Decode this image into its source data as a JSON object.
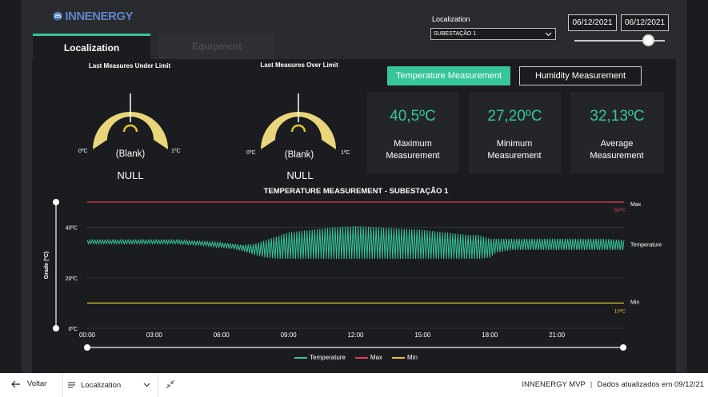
{
  "brand": {
    "name": "INNENERGY"
  },
  "tabs": [
    {
      "label": "Localization",
      "active": true
    },
    {
      "label": "Equipment",
      "active": false
    }
  ],
  "filters": {
    "localization_label": "Localization",
    "localization_value": "SUBESTAÇÃO 1",
    "date_start": "06/12/2021",
    "date_end": "06/12/2021"
  },
  "gauges": [
    {
      "title": "Last Measures Under Limit",
      "min": "0ºC",
      "max": "1ºC",
      "center": "(Blank)",
      "value": "NULL"
    },
    {
      "title": "Last Measures Over Limit",
      "min": "0ºC",
      "max": "1ºC",
      "center": "(Blank)",
      "value": "NULL"
    }
  ],
  "toggles": {
    "temperature": "Temperature Measurement",
    "humidity": "Humidity Measurement"
  },
  "cards": [
    {
      "value": "40,5ºC",
      "label": "Maximum Measurement"
    },
    {
      "value": "27,20ºC",
      "label": "Minimum Measurement"
    },
    {
      "value": "32,13ºC",
      "label": "Average Measurement"
    }
  ],
  "colors": {
    "accent": "#37c59c",
    "max": "#e0434f",
    "min": "#e0c62c",
    "gauge": "#e9d57a"
  },
  "chart_data": {
    "type": "line",
    "title": "TEMPERATURE MEASUREMENT - SUBESTAÇÃO 1",
    "ylabel": "Grade (ºC)",
    "xlabel": "",
    "ylim": [
      0,
      50
    ],
    "xlim": [
      0,
      24
    ],
    "x_ticks": [
      "00:00",
      "03:00",
      "06:00",
      "09:00",
      "12:00",
      "15:00",
      "18:00",
      "21:00"
    ],
    "y_ticks": [
      "40ºC",
      "20ºC",
      "0ºC"
    ],
    "max_line": {
      "value": 50,
      "label": "50ºC",
      "name": "Max"
    },
    "min_line": {
      "value": 10,
      "label": "10ºC",
      "name": "Min"
    },
    "series_label": "Temperature",
    "legend": [
      "Temperature",
      "Max",
      "Min"
    ],
    "series": [
      {
        "name": "Temperature",
        "envelope_low": [
          [
            0.0,
            33.5
          ],
          [
            1.0,
            33.5
          ],
          [
            2.0,
            33.5
          ],
          [
            3.0,
            33.5
          ],
          [
            4.0,
            33.5
          ],
          [
            5.0,
            33.0
          ],
          [
            6.0,
            32.0
          ],
          [
            6.5,
            31.5
          ],
          [
            7.0,
            30.5
          ],
          [
            7.5,
            29.0
          ],
          [
            8.0,
            28.0
          ],
          [
            8.5,
            27.5
          ],
          [
            9.0,
            27.5
          ],
          [
            10.0,
            27.5
          ],
          [
            11.0,
            27.5
          ],
          [
            12.0,
            27.5
          ],
          [
            13.0,
            27.5
          ],
          [
            14.0,
            27.5
          ],
          [
            15.0,
            27.5
          ],
          [
            16.0,
            27.5
          ],
          [
            17.0,
            27.5
          ],
          [
            17.5,
            27.5
          ],
          [
            18.0,
            28.0
          ],
          [
            18.3,
            30.0
          ],
          [
            19.0,
            31.0
          ],
          [
            20.0,
            31.0
          ],
          [
            21.0,
            31.0
          ],
          [
            22.0,
            31.0
          ],
          [
            23.0,
            31.0
          ],
          [
            24.0,
            31.0
          ]
        ],
        "envelope_high": [
          [
            0.0,
            35.0
          ],
          [
            1.0,
            35.0
          ],
          [
            2.0,
            35.0
          ],
          [
            3.0,
            35.0
          ],
          [
            4.0,
            35.0
          ],
          [
            5.0,
            34.5
          ],
          [
            6.0,
            34.0
          ],
          [
            6.5,
            33.5
          ],
          [
            7.0,
            33.0
          ],
          [
            7.5,
            33.5
          ],
          [
            8.0,
            35.0
          ],
          [
            8.5,
            36.5
          ],
          [
            9.0,
            38.0
          ],
          [
            10.0,
            39.0
          ],
          [
            11.0,
            40.0
          ],
          [
            12.0,
            40.5
          ],
          [
            13.0,
            40.0
          ],
          [
            14.0,
            39.5
          ],
          [
            15.0,
            39.0
          ],
          [
            16.0,
            38.0
          ],
          [
            17.0,
            37.0
          ],
          [
            17.5,
            37.0
          ],
          [
            18.0,
            35.5
          ],
          [
            18.3,
            35.5
          ],
          [
            19.0,
            35.5
          ],
          [
            20.0,
            35.5
          ],
          [
            21.0,
            35.5
          ],
          [
            22.0,
            35.5
          ],
          [
            23.0,
            35.5
          ],
          [
            24.0,
            35.0
          ]
        ]
      }
    ]
  },
  "bottom_bar": {
    "back": "Voltar",
    "page": "Localization",
    "app": "INNENERGY MVP",
    "updated": "Dados atualizados em 09/12/21"
  }
}
